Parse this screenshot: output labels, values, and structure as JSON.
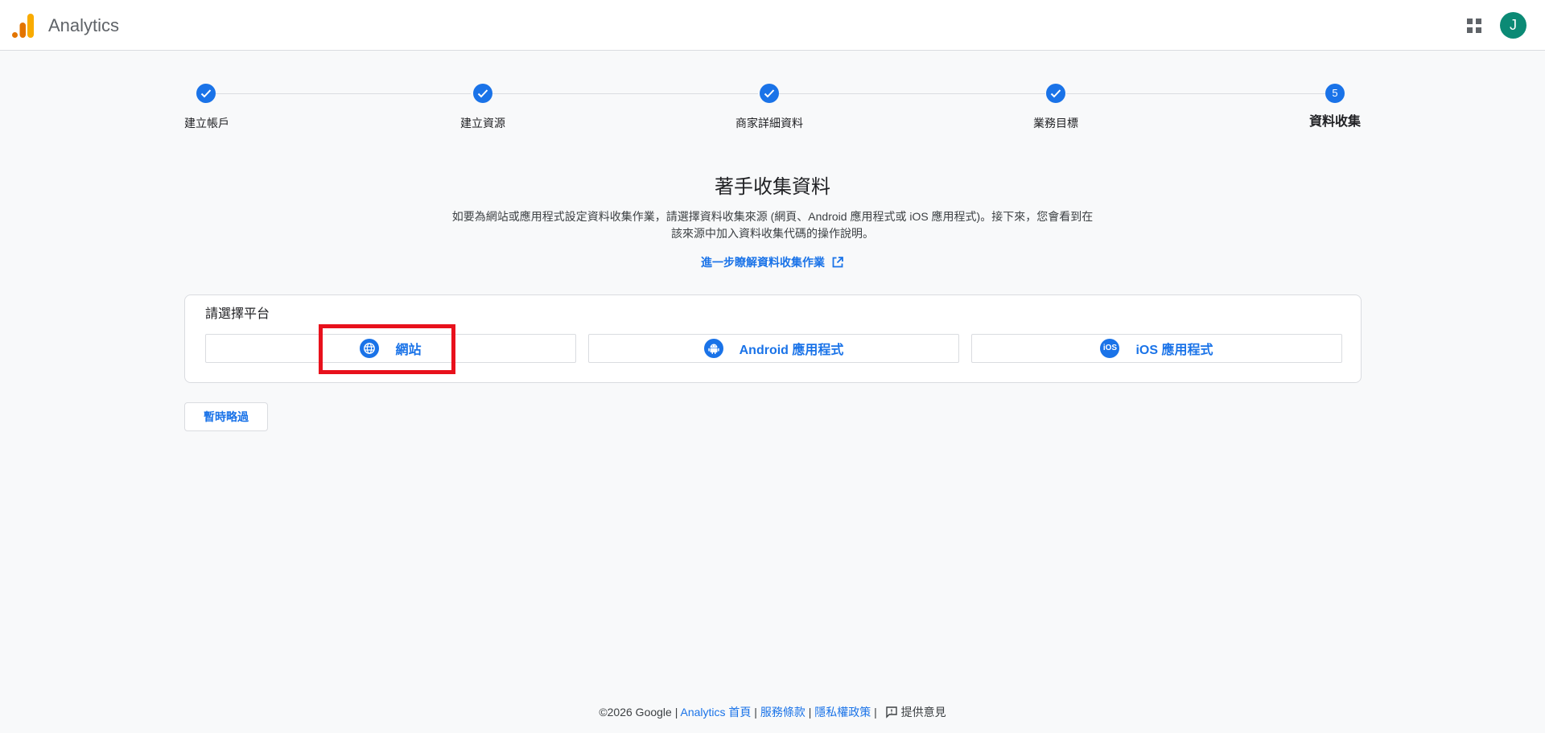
{
  "header": {
    "app_name": "Analytics",
    "avatar_letter": "J"
  },
  "stepper": {
    "steps": [
      {
        "label": "建立帳戶",
        "status": "done"
      },
      {
        "label": "建立資源",
        "status": "done"
      },
      {
        "label": "商家詳細資料",
        "status": "done"
      },
      {
        "label": "業務目標",
        "status": "done"
      },
      {
        "label": "資料收集",
        "status": "active",
        "number": "5"
      }
    ]
  },
  "main": {
    "title": "著手收集資料",
    "description": "如要為網站或應用程式設定資料收集作業，請選擇資料收集來源 (網頁、Android 應用程式或 iOS 應用程式)。接下來，您會看到在該來源中加入資料收集代碼的操作說明。",
    "learn_more": "進一步瞭解資料收集作業"
  },
  "platform": {
    "title": "請選擇平台",
    "options": [
      {
        "label": "網站",
        "icon": "globe-icon"
      },
      {
        "label": "Android 應用程式",
        "icon": "android-icon"
      },
      {
        "label": "iOS 應用程式",
        "icon": "ios-icon",
        "icon_text": "iOS"
      }
    ]
  },
  "skip_label": "暫時略過",
  "footer": {
    "copyright": "©2026 Google",
    "sep": "|",
    "links": [
      "Analytics 首頁",
      "服務條款",
      "隱私權政策"
    ],
    "feedback": "提供意見"
  },
  "colors": {
    "accent": "#1a73e8",
    "avatar_bg": "#0b8a75",
    "highlight": "#e8111c",
    "logo_orange": "#f9ab00",
    "logo_dark_orange": "#e37400"
  }
}
